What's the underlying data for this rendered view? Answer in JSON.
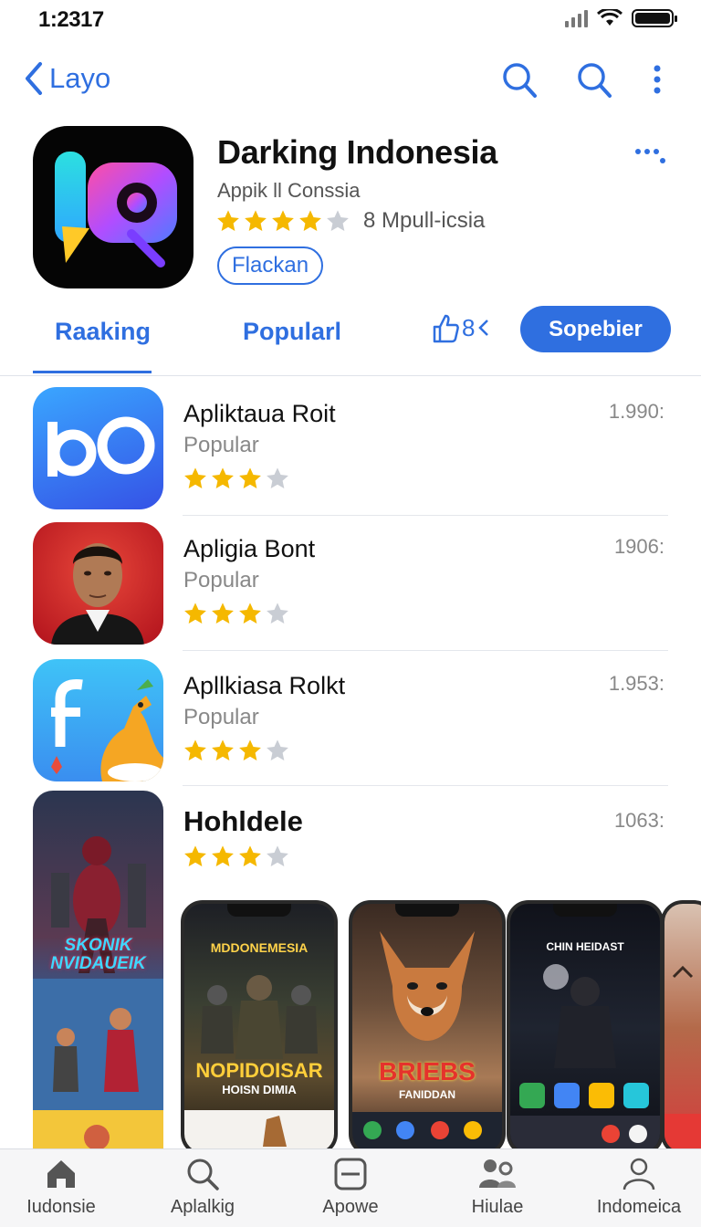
{
  "status_bar": {
    "time": "1:2317"
  },
  "nav": {
    "back_label": "Layo"
  },
  "app": {
    "title": "Darking Indonesia",
    "subtitle": "Appik ll Conssia",
    "rating_text": "8 Mpull-icsia",
    "tag_label": "Flackan"
  },
  "tabs": {
    "ranking": "Raaking",
    "popular": "Popularl",
    "like_count": "8",
    "subscribe": "Sopebier"
  },
  "list": [
    {
      "name": "Apliktaua Roit",
      "category": "Popular",
      "count": "1.990:",
      "rating": 3
    },
    {
      "name": "Apligia Bont",
      "category": "Popular",
      "count": "1906:",
      "rating": 3
    },
    {
      "name": "Apllkiasa Rolkt",
      "category": "Popular",
      "count": "1.953:",
      "rating": 3
    }
  ],
  "featured": {
    "name": "Hohldele",
    "count": "1063:",
    "rating": 3,
    "poster_text": "SKONIK NVIDAUEIK",
    "screenshots": [
      {
        "top_text": "MDDONEMESIA",
        "bottom_text": "NOPIDOISAR",
        "sub_text": "HOISN DIMIA"
      },
      {
        "top_text": "",
        "bottom_text": "BRIEBS",
        "sub_text": "FANIDDAN"
      },
      {
        "top_text": "CHIN HEIDAST",
        "bottom_text": "",
        "sub_text": ""
      }
    ]
  },
  "tabbar": {
    "items": [
      {
        "label": "Iudonsie",
        "icon": "home-icon"
      },
      {
        "label": "Aplalkig",
        "icon": "search-icon"
      },
      {
        "label": "Apowe",
        "icon": "apps-icon"
      },
      {
        "label": "Hiulae",
        "icon": "people-icon"
      },
      {
        "label": "Indomeica",
        "icon": "profile-icon"
      }
    ]
  },
  "colors": {
    "accent": "#2f6fe0",
    "star": "#f5b800",
    "star_empty": "#c9cdd4"
  }
}
